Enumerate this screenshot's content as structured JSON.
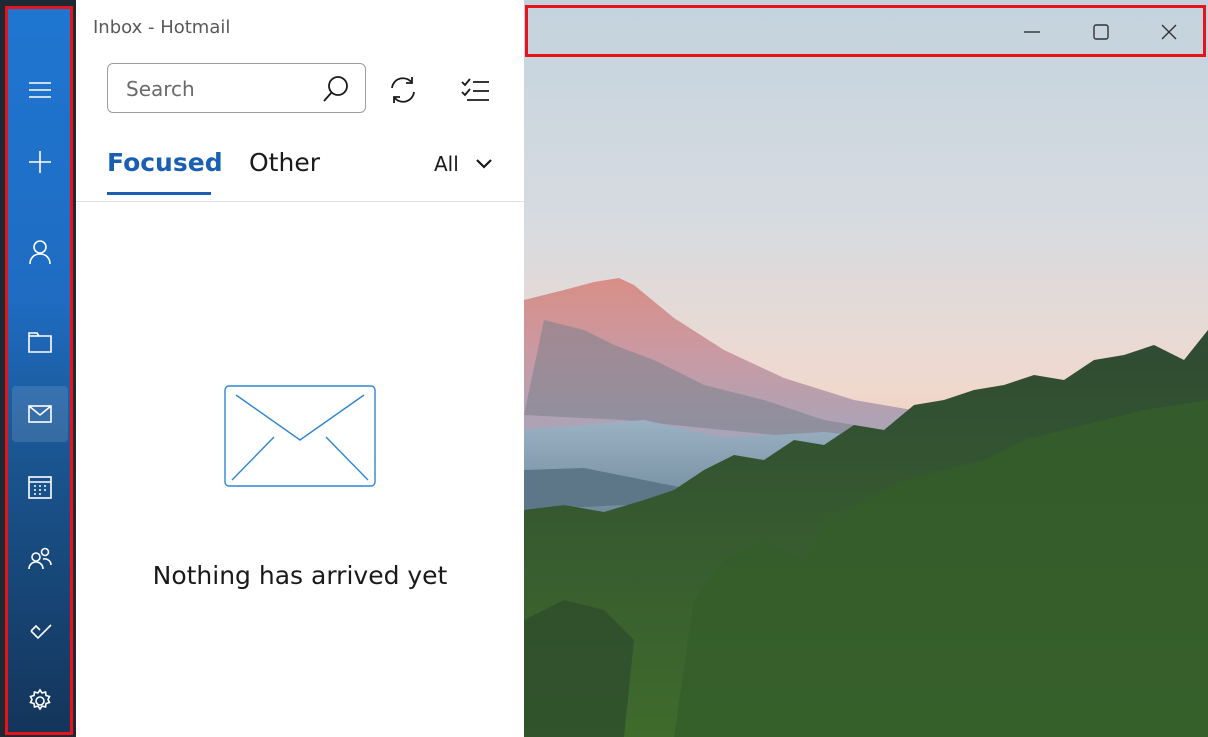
{
  "window": {
    "title": "Inbox - Hotmail"
  },
  "nav": {
    "items": [
      {
        "name": "menu",
        "icon": "hamburger-icon"
      },
      {
        "name": "new-mail",
        "icon": "plus-icon"
      },
      {
        "name": "accounts",
        "icon": "person-icon"
      },
      {
        "name": "folders",
        "icon": "folder-icon"
      },
      {
        "name": "mail",
        "icon": "mail-icon",
        "active": true
      },
      {
        "name": "calendar",
        "icon": "calendar-icon"
      },
      {
        "name": "people",
        "icon": "people-icon"
      },
      {
        "name": "todo",
        "icon": "check-icon"
      },
      {
        "name": "settings",
        "icon": "gear-icon"
      }
    ]
  },
  "search": {
    "placeholder": "Search"
  },
  "tabs": {
    "focused": "Focused",
    "other": "Other"
  },
  "filter": {
    "label": "All"
  },
  "empty": {
    "message": "Nothing has arrived yet"
  },
  "colors": {
    "accent": "#1a5fb4",
    "rail": "#1f76d0",
    "highlight": "#e8121a"
  }
}
